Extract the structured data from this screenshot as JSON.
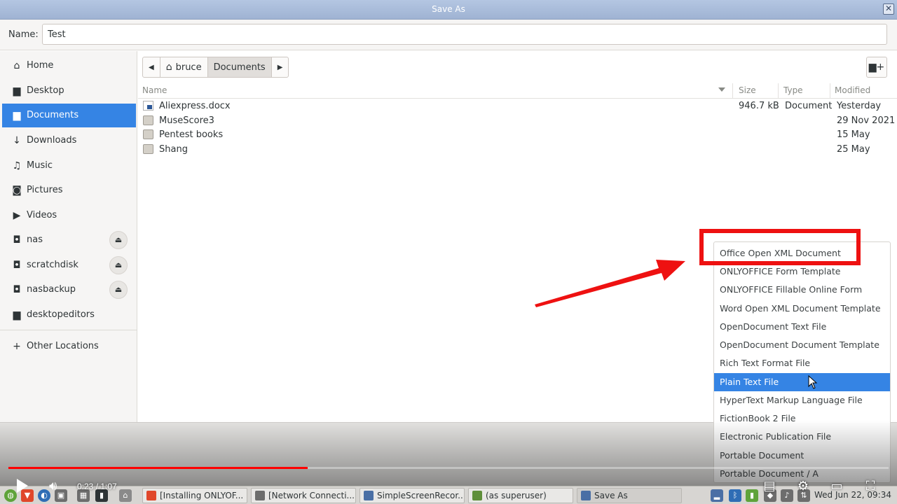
{
  "window": {
    "title": "Save As",
    "close_glyph": "✕"
  },
  "name_row": {
    "label": "Name:",
    "value": "Test"
  },
  "sidebar": {
    "items": [
      {
        "label": "Home",
        "icon": "home-icon"
      },
      {
        "label": "Desktop",
        "icon": "desktop-icon"
      },
      {
        "label": "Documents",
        "icon": "documents-icon"
      },
      {
        "label": "Downloads",
        "icon": "downloads-icon"
      },
      {
        "label": "Music",
        "icon": "music-icon"
      },
      {
        "label": "Pictures",
        "icon": "pictures-icon"
      },
      {
        "label": "Videos",
        "icon": "videos-icon"
      },
      {
        "label": "nas",
        "icon": "network-drive-icon"
      },
      {
        "label": "scratchdisk",
        "icon": "network-drive-icon"
      },
      {
        "label": "nasbackup",
        "icon": "network-drive-icon"
      },
      {
        "label": "desktopeditors",
        "icon": "folder-icon"
      },
      {
        "label": "Other Locations",
        "icon": "plus-icon"
      }
    ],
    "active": "Documents"
  },
  "pathbar": {
    "segments": [
      "bruce",
      "Documents"
    ]
  },
  "file_list": {
    "columns": [
      "Name",
      "Size",
      "Type",
      "Modified"
    ],
    "rows": [
      {
        "name": "Aliexpress.docx",
        "size": "946.7 kB",
        "type": "Document",
        "modified": "Yesterday",
        "icon": "docx-file-icon"
      },
      {
        "name": "MuseScore3",
        "size": "",
        "type": "",
        "modified": "29 Nov 2021",
        "icon": "folder-icon"
      },
      {
        "name": "Pentest books",
        "size": "",
        "type": "",
        "modified": "15 May",
        "icon": "folder-icon"
      },
      {
        "name": "Shang",
        "size": "",
        "type": "",
        "modified": "25 May",
        "icon": "folder-icon"
      }
    ]
  },
  "file_types": {
    "items": [
      "Office Open XML Document",
      "ONLYOFFICE Form Template",
      "ONLYOFFICE Fillable Online Form",
      "Word Open XML Document Template",
      "OpenDocument Text File",
      "OpenDocument Document Template",
      "Rich Text Format File",
      "Plain Text File",
      "HyperText Markup Language File",
      "FictionBook 2 File",
      "Electronic Publication File",
      "Portable Document",
      "Portable Document / A"
    ],
    "selected": "Plain Text File",
    "highlighted": "Office Open XML Document"
  },
  "video": {
    "time": "0:23 / 1:07",
    "progress": 0.34,
    "accent": "#ff0000"
  },
  "taskbar": {
    "tasks": [
      "[Installing ONLYOF...",
      "[Network Connecti...",
      "SimpleScreenRecor...",
      "(as superuser)",
      "Save As"
    ],
    "clock": "Wed Jun 22, 09:34"
  },
  "colors": {
    "selection": "#3584e4",
    "annotation": "#ee1111"
  }
}
